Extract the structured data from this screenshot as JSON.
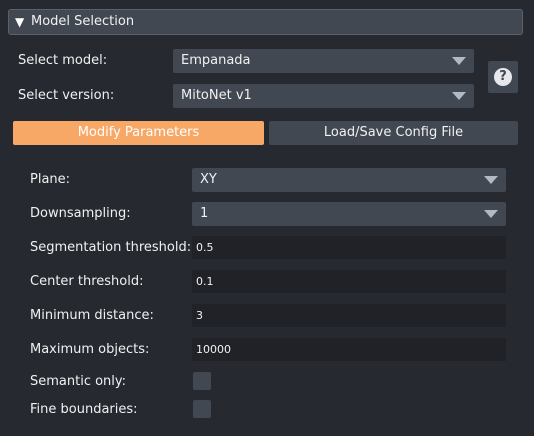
{
  "section": {
    "toggle_glyph": "▼",
    "title": "Model Selection"
  },
  "model": {
    "label": "Select model:",
    "value": "Empanada"
  },
  "version": {
    "label": "Select version:",
    "value": "MitoNet v1"
  },
  "help": {
    "glyph": "?",
    "icon": "help-icon"
  },
  "tabs": [
    {
      "label": "Modify Parameters",
      "active": true
    },
    {
      "label": "Load/Save Config File",
      "active": false
    }
  ],
  "params": {
    "plane": {
      "label": "Plane:",
      "value": "XY"
    },
    "downsampling": {
      "label": "Downsampling:",
      "value": "1"
    },
    "seg_threshold": {
      "label": "Segmentation threshold:",
      "value": "0.5"
    },
    "center_threshold": {
      "label": "Center threshold:",
      "value": "0.1"
    },
    "min_distance": {
      "label": "Minimum distance:",
      "value": "3"
    },
    "max_objects": {
      "label": "Maximum objects:",
      "value": "10000"
    },
    "semantic_only": {
      "label": "Semantic only:",
      "checked": false
    },
    "fine_boundaries": {
      "label": "Fine boundaries:",
      "checked": false
    }
  },
  "colors": {
    "background": "#262930",
    "control": "#414851",
    "field": "#202227",
    "accent": "#f7a867"
  }
}
